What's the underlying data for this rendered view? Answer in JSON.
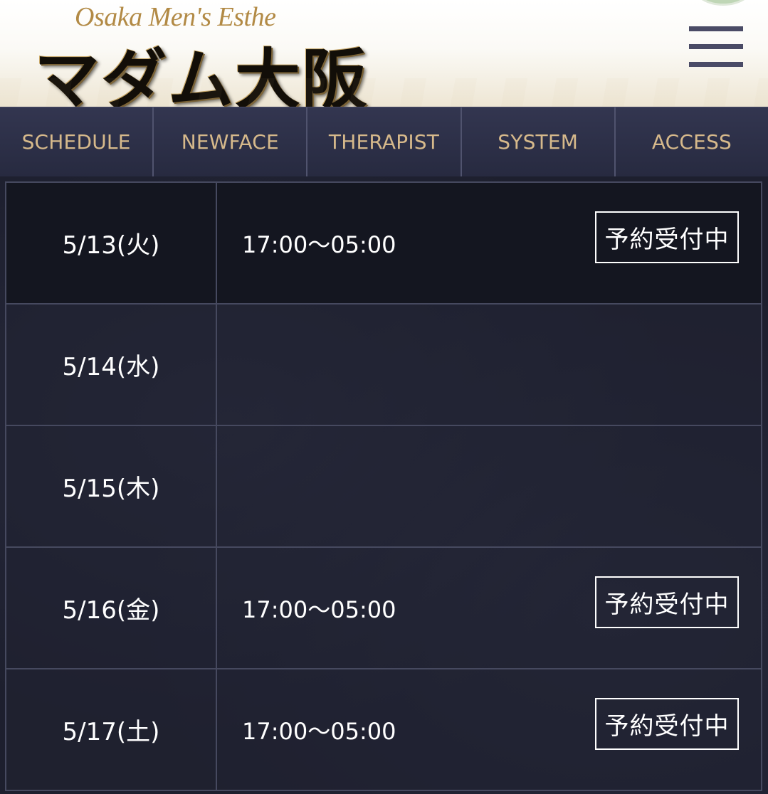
{
  "header": {
    "logo_subtitle": "Osaka Men's Esthe",
    "logo_title": "マダム大阪"
  },
  "nav": {
    "items": [
      "SCHEDULE",
      "NEWFACE",
      "THERAPIST",
      "SYSTEM",
      "ACCESS"
    ]
  },
  "schedule": {
    "rows": [
      {
        "date": "5/13(火)",
        "time": "17:00〜05:00",
        "status": "予約受付中"
      },
      {
        "date": "5/14(水)",
        "time": "",
        "status": ""
      },
      {
        "date": "5/15(木)",
        "time": "",
        "status": ""
      },
      {
        "date": "5/16(金)",
        "time": "17:00〜05:00",
        "status": "予約受付中"
      },
      {
        "date": "5/17(土)",
        "time": "17:00〜05:00",
        "status": "予約受付中"
      }
    ]
  },
  "icons": {
    "menu": "hamburger-menu-icon"
  },
  "colors": {
    "nav_text": "#d6b98b",
    "logo_accent": "#b28a45",
    "background": "#1d1f2e"
  }
}
